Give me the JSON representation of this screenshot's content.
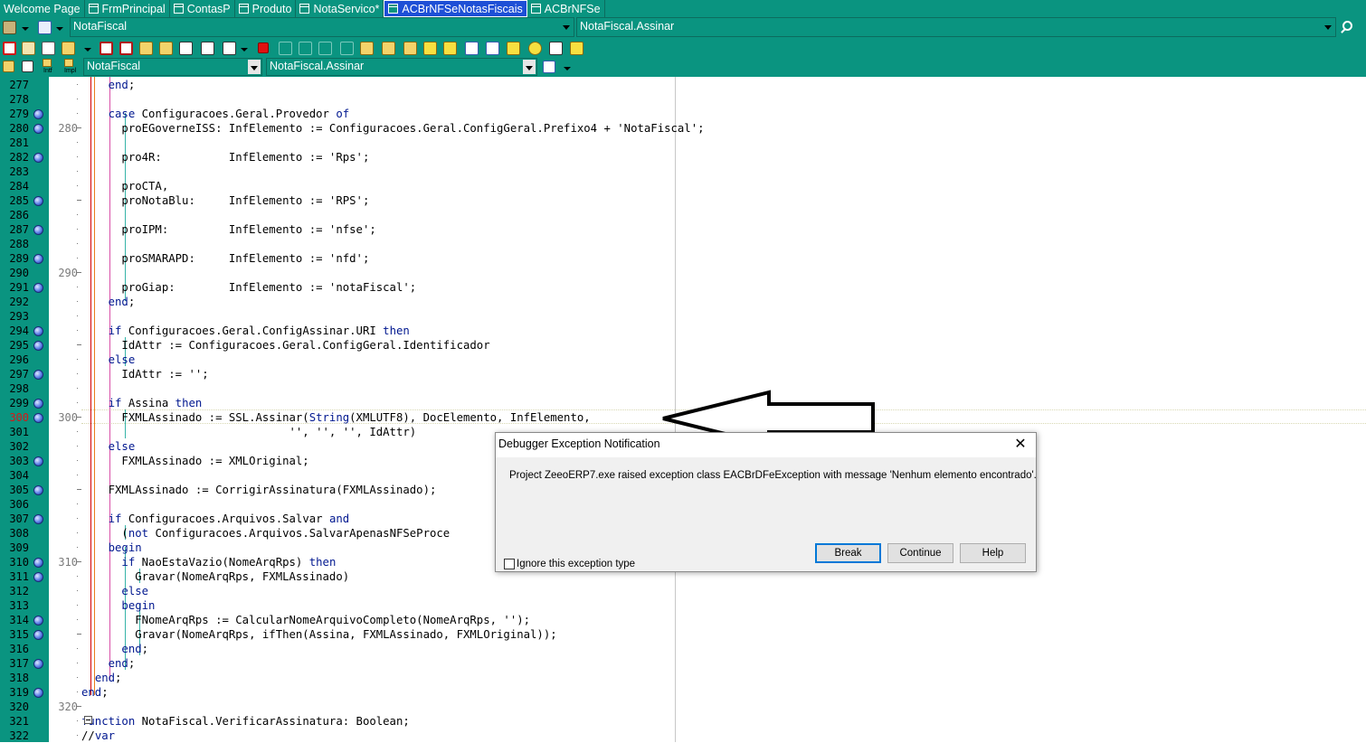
{
  "tabs": [
    {
      "label": "Welcome Page",
      "active": false,
      "icon": "none"
    },
    {
      "label": "FrmPrincipal",
      "active": false,
      "icon": "form-icon"
    },
    {
      "label": "ContasP",
      "active": false,
      "icon": "form-icon"
    },
    {
      "label": "Produto",
      "active": false,
      "icon": "form-icon"
    },
    {
      "label": "NotaServico*",
      "active": false,
      "icon": "form-icon"
    },
    {
      "label": "ACBrNFSeNotasFiscais",
      "active": true,
      "icon": "form-icon"
    },
    {
      "label": "ACBrNFSe",
      "active": false,
      "icon": "form-icon"
    }
  ],
  "toolbar": {
    "unit_combo": "NotaFiscal",
    "method_combo": "NotaFiscal.Assinar",
    "class_combo": "NotaFiscal",
    "member_combo": "NotaFiscal.Assinar",
    "small_labels": [
      "Intf",
      "Impl"
    ]
  },
  "editor": {
    "current_line": 300,
    "lines": [
      {
        "n": 277,
        "bp": false,
        "text": [
          [
            "",
            "    "
          ],
          [
            "kw",
            "end"
          ],
          [
            "",
            ";"
          ]
        ]
      },
      {
        "n": 278,
        "bp": false,
        "text": [
          [
            "",
            ""
          ]
        ]
      },
      {
        "n": 279,
        "bp": true,
        "text": [
          [
            "",
            "    "
          ],
          [
            "kw",
            "case"
          ],
          [
            "",
            " Configuracoes.Geral.Provedor "
          ],
          [
            "kw",
            "of"
          ]
        ]
      },
      {
        "n": 280,
        "bp": true,
        "text": [
          [
            "",
            "      proEGoverneISS: InfElemento := Configuracoes.Geral.ConfigGeral.Prefixo4 + 'NotaFiscal';"
          ]
        ]
      },
      {
        "n": 281,
        "bp": false,
        "text": [
          [
            "",
            ""
          ]
        ]
      },
      {
        "n": 282,
        "bp": true,
        "text": [
          [
            "",
            "      pro4R:          InfElemento := 'Rps';"
          ]
        ]
      },
      {
        "n": 283,
        "bp": false,
        "text": [
          [
            "",
            ""
          ]
        ]
      },
      {
        "n": 284,
        "bp": false,
        "text": [
          [
            "",
            "      proCTA,"
          ]
        ]
      },
      {
        "n": 285,
        "bp": true,
        "text": [
          [
            "",
            "      proNotaBlu:     InfElemento := 'RPS';"
          ]
        ]
      },
      {
        "n": 286,
        "bp": false,
        "text": [
          [
            "",
            ""
          ]
        ]
      },
      {
        "n": 287,
        "bp": true,
        "text": [
          [
            "",
            "      proIPM:         InfElemento := 'nfse';"
          ]
        ]
      },
      {
        "n": 288,
        "bp": false,
        "text": [
          [
            "",
            ""
          ]
        ]
      },
      {
        "n": 289,
        "bp": true,
        "text": [
          [
            "",
            "      proSMARAPD:     InfElemento := 'nfd';"
          ]
        ]
      },
      {
        "n": 290,
        "bp": false,
        "text": [
          [
            "",
            ""
          ]
        ]
      },
      {
        "n": 291,
        "bp": true,
        "text": [
          [
            "",
            "      proGiap:        InfElemento := 'notaFiscal';"
          ]
        ]
      },
      {
        "n": 292,
        "bp": false,
        "text": [
          [
            "",
            "    "
          ],
          [
            "kw",
            "end"
          ],
          [
            "",
            ";"
          ]
        ]
      },
      {
        "n": 293,
        "bp": false,
        "text": [
          [
            "",
            ""
          ]
        ]
      },
      {
        "n": 294,
        "bp": true,
        "text": [
          [
            "",
            "    "
          ],
          [
            "kw",
            "if"
          ],
          [
            "",
            " Configuracoes.Geral.ConfigAssinar.URI "
          ],
          [
            "kw",
            "then"
          ]
        ]
      },
      {
        "n": 295,
        "bp": true,
        "text": [
          [
            "",
            "      IdAttr := Configuracoes.Geral.ConfigGeral.Identificador"
          ]
        ]
      },
      {
        "n": 296,
        "bp": false,
        "text": [
          [
            "",
            "    "
          ],
          [
            "kw",
            "else"
          ]
        ]
      },
      {
        "n": 297,
        "bp": true,
        "text": [
          [
            "",
            "      IdAttr := '';"
          ]
        ]
      },
      {
        "n": 298,
        "bp": false,
        "text": [
          [
            "",
            ""
          ]
        ]
      },
      {
        "n": 299,
        "bp": true,
        "text": [
          [
            "",
            "    "
          ],
          [
            "kw",
            "if"
          ],
          [
            "",
            " Assina "
          ],
          [
            "kw",
            "then"
          ]
        ]
      },
      {
        "n": 300,
        "bp": true,
        "text": [
          [
            "",
            "      FXMLAssinado := SSL.Assinar("
          ],
          [
            "kw",
            "String"
          ],
          [
            "",
            "(XMLUTF8), DocElemento, InfElemento,"
          ]
        ]
      },
      {
        "n": 301,
        "bp": false,
        "text": [
          [
            "",
            "                               '', '', '', IdAttr)"
          ]
        ]
      },
      {
        "n": 302,
        "bp": false,
        "text": [
          [
            "",
            "    "
          ],
          [
            "kw",
            "else"
          ]
        ]
      },
      {
        "n": 303,
        "bp": true,
        "text": [
          [
            "",
            "      FXMLAssinado := XMLOriginal;"
          ]
        ]
      },
      {
        "n": 304,
        "bp": false,
        "text": [
          [
            "",
            ""
          ]
        ]
      },
      {
        "n": 305,
        "bp": true,
        "text": [
          [
            "",
            "    FXMLAssinado := CorrigirAssinatura(FXMLAssinado);"
          ]
        ]
      },
      {
        "n": 306,
        "bp": false,
        "text": [
          [
            "",
            ""
          ]
        ]
      },
      {
        "n": 307,
        "bp": true,
        "text": [
          [
            "",
            "    "
          ],
          [
            "kw",
            "if"
          ],
          [
            "",
            " Configuracoes.Arquivos.Salvar "
          ],
          [
            "kw",
            "and"
          ]
        ]
      },
      {
        "n": 308,
        "bp": false,
        "text": [
          [
            "",
            "      ("
          ],
          [
            "kw",
            "not"
          ],
          [
            "",
            " Configuracoes.Arquivos.SalvarApenasNFSeProce"
          ]
        ]
      },
      {
        "n": 309,
        "bp": false,
        "text": [
          [
            "",
            "    "
          ],
          [
            "kw",
            "begin"
          ]
        ]
      },
      {
        "n": 310,
        "bp": true,
        "text": [
          [
            "",
            "      "
          ],
          [
            "kw",
            "if"
          ],
          [
            "",
            " NaoEstaVazio(NomeArqRps) "
          ],
          [
            "kw",
            "then"
          ]
        ]
      },
      {
        "n": 311,
        "bp": true,
        "text": [
          [
            "",
            "        Gravar(NomeArqRps, FXMLAssinado)"
          ]
        ]
      },
      {
        "n": 312,
        "bp": false,
        "text": [
          [
            "",
            "      "
          ],
          [
            "kw",
            "else"
          ]
        ]
      },
      {
        "n": 313,
        "bp": false,
        "text": [
          [
            "",
            "      "
          ],
          [
            "kw",
            "begin"
          ]
        ]
      },
      {
        "n": 314,
        "bp": true,
        "text": [
          [
            "",
            "        FNomeArqRps := CalcularNomeArquivoCompleto(NomeArqRps, '');"
          ]
        ]
      },
      {
        "n": 315,
        "bp": true,
        "text": [
          [
            "",
            "        Gravar(NomeArqRps, ifThen(Assina, FXMLAssinado, FXMLOriginal));"
          ]
        ]
      },
      {
        "n": 316,
        "bp": false,
        "text": [
          [
            "",
            "      "
          ],
          [
            "kw",
            "end"
          ],
          [
            "",
            ";"
          ]
        ]
      },
      {
        "n": 317,
        "bp": true,
        "text": [
          [
            "",
            "    "
          ],
          [
            "kw",
            "end"
          ],
          [
            "",
            ";"
          ]
        ]
      },
      {
        "n": 318,
        "bp": false,
        "text": [
          [
            "",
            "  "
          ],
          [
            "kw",
            "end"
          ],
          [
            "",
            ";"
          ]
        ]
      },
      {
        "n": 319,
        "bp": true,
        "text": [
          [
            "",
            ""
          ],
          [
            "kw",
            "end"
          ],
          [
            "",
            ";"
          ]
        ]
      },
      {
        "n": 320,
        "bp": false,
        "text": [
          [
            "",
            ""
          ]
        ]
      },
      {
        "n": 321,
        "bp": false,
        "text": [
          [
            "",
            ""
          ],
          [
            "kw",
            "function"
          ],
          [
            "",
            " NotaFiscal.VerificarAssinatura: Boolean;"
          ]
        ]
      },
      {
        "n": 322,
        "bp": false,
        "text": [
          [
            "",
            "//"
          ],
          [
            "kw",
            "var"
          ]
        ]
      }
    ],
    "margin_numbers": [
      280,
      290,
      300,
      310,
      320
    ]
  },
  "dialog": {
    "title": "Debugger Exception Notification",
    "message": "Project ZeeoERP7.exe raised exception class EACBrDFeException with message 'Nenhum elemento encontrado'.",
    "checkbox_label": "Ignore this exception type",
    "buttons": {
      "break": "Break",
      "continue": "Continue",
      "help": "Help"
    }
  },
  "colors": {
    "ide_teal": "#0a9480",
    "keyword": "#00178f",
    "active_tab": "#1e4fd6",
    "current_line_number": "#d61818"
  }
}
